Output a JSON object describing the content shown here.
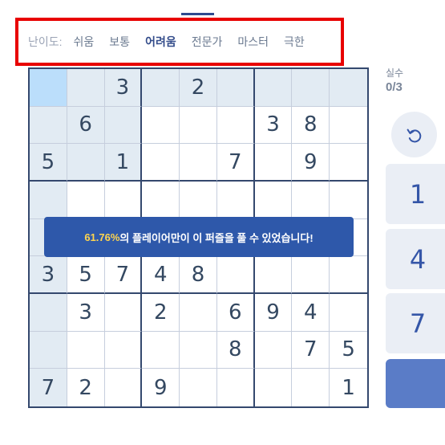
{
  "difficulty": {
    "label": "난이도:",
    "options": [
      "쉬움",
      "보통",
      "어려움",
      "전문가",
      "마스터",
      "극한"
    ],
    "selected": "어려움"
  },
  "board": {
    "rows": [
      [
        "",
        "",
        "3",
        "",
        "2",
        "",
        "",
        "",
        ""
      ],
      [
        "",
        "6",
        "",
        "",
        "",
        "",
        "3",
        "8",
        ""
      ],
      [
        "5",
        "",
        "1",
        "",
        "",
        "7",
        "",
        "9",
        ""
      ],
      [
        "",
        "",
        "",
        "",
        "",
        "",
        "",
        "",
        ""
      ],
      [
        "",
        "",
        "",
        "",
        "",
        "",
        "",
        "",
        ""
      ],
      [
        "3",
        "5",
        "7",
        "4",
        "8",
        "",
        "",
        "",
        ""
      ],
      [
        "",
        "3",
        "",
        "2",
        "",
        "6",
        "9",
        "4",
        ""
      ],
      [
        "",
        "",
        "",
        "",
        "",
        "8",
        "",
        "7",
        "5"
      ],
      [
        "7",
        "2",
        "",
        "9",
        "",
        "",
        "",
        "",
        "1"
      ]
    ]
  },
  "toast": {
    "percent": "61.76%",
    "message": "의 플레이어만이 이 퍼즐을 풀 수 있었습니다!"
  },
  "stats": {
    "mistakes_label": "실수",
    "mistakes_value": "0/3"
  },
  "controls": {
    "undo_icon": "undo-icon",
    "number_buttons": [
      "1",
      "4",
      "7",
      ""
    ]
  },
  "colors": {
    "accent": "#2e58aa",
    "highlight": "#e2ebf3",
    "selected": "#bbdefb",
    "toast_percent": "#ffd54f",
    "difficulty_frame": "#e80000"
  }
}
